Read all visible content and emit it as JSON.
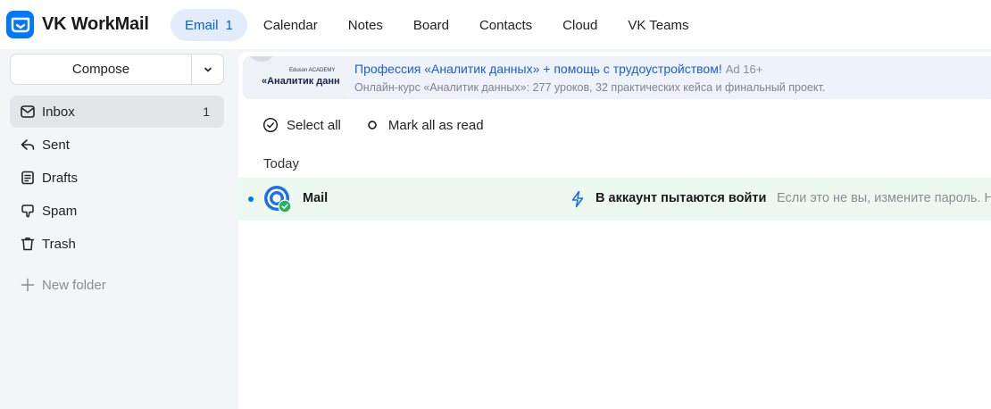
{
  "app": {
    "name": "VK WorkMail",
    "logo_icon": "vk-workmail-logo-icon",
    "accent": "#0077ff"
  },
  "nav": {
    "items": [
      {
        "label": "Email",
        "badge": "1",
        "active": true
      },
      {
        "label": "Calendar"
      },
      {
        "label": "Notes"
      },
      {
        "label": "Board"
      },
      {
        "label": "Contacts"
      },
      {
        "label": "Cloud"
      },
      {
        "label": "VK Teams"
      }
    ]
  },
  "sidebar": {
    "compose_label": "Compose",
    "folders": [
      {
        "label": "Inbox",
        "count": "1",
        "icon": "inbox-icon",
        "active": true
      },
      {
        "label": "Sent",
        "icon": "sent-icon"
      },
      {
        "label": "Drafts",
        "icon": "drafts-icon"
      },
      {
        "label": "Spam",
        "icon": "spam-icon"
      },
      {
        "label": "Trash",
        "icon": "trash-icon"
      }
    ],
    "new_folder_label": "New folder"
  },
  "ad": {
    "image_brand": "Eduson ACADEMY",
    "image_text": "«Аналитик данн",
    "title": "Профессия «Аналитик данных» + помощь с трудоустройством!",
    "marker": "Ad 16+",
    "description": "Онлайн-курс «Аналитик данных»: 277 уроков, 32 практических кейса и финальный проект."
  },
  "toolbar": {
    "select_all_label": "Select all",
    "mark_all_read_label": "Mark all as read"
  },
  "mail_list": {
    "group_label": "Today",
    "messages": [
      {
        "sender": "Mail",
        "subject": "В аккаунт пытаются войти",
        "snippet": "Если это не вы, измените пароль. Н",
        "unread": true,
        "row_color": "#edf8f1"
      }
    ]
  }
}
